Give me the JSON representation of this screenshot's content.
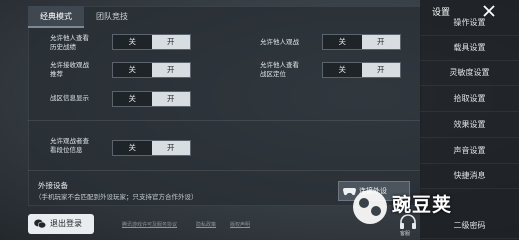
{
  "tabs": [
    {
      "label": "经典模式",
      "active": true
    },
    {
      "label": "团队竞技",
      "active": false
    }
  ],
  "toggle_rows": [
    {
      "label_line1": "允许他人查看",
      "label_line2": "历史战绩",
      "off": "关",
      "on": "开"
    },
    {
      "label_line1": "允许他人观战",
      "label_line2": "",
      "off": "关",
      "on": "开"
    },
    {
      "label_line1": "允许接收观战",
      "label_line2": "推荐",
      "off": "关",
      "on": "开"
    },
    {
      "label_line1": "允许他人查看",
      "label_line2": "战区定位",
      "off": "关",
      "on": "开"
    },
    {
      "label_line1": "战区信息显示",
      "label_line2": "",
      "off": "关",
      "on": "开"
    },
    {
      "label_line1": "允许观战者查",
      "label_line2": "看段位信息",
      "off": "关",
      "on": "开"
    }
  ],
  "external_device": {
    "title": "外接设备",
    "note": "（手机玩家不会匹配到外设玩家；只支持官方合作外设）",
    "button_label": "连接外设"
  },
  "logout_label": "退出登录",
  "footer_links": [
    "腾讯游戏许可及服务协议",
    "隐私政策",
    "版权声明"
  ],
  "sidebar": {
    "title": "设置",
    "items": [
      "操作设置",
      "载具设置",
      "灵敏度设置",
      "拾取设置",
      "效果设置",
      "声音设置",
      "快捷消息",
      "二级密码"
    ]
  },
  "voice_label": "客服",
  "watermark_text": "豌豆荚"
}
